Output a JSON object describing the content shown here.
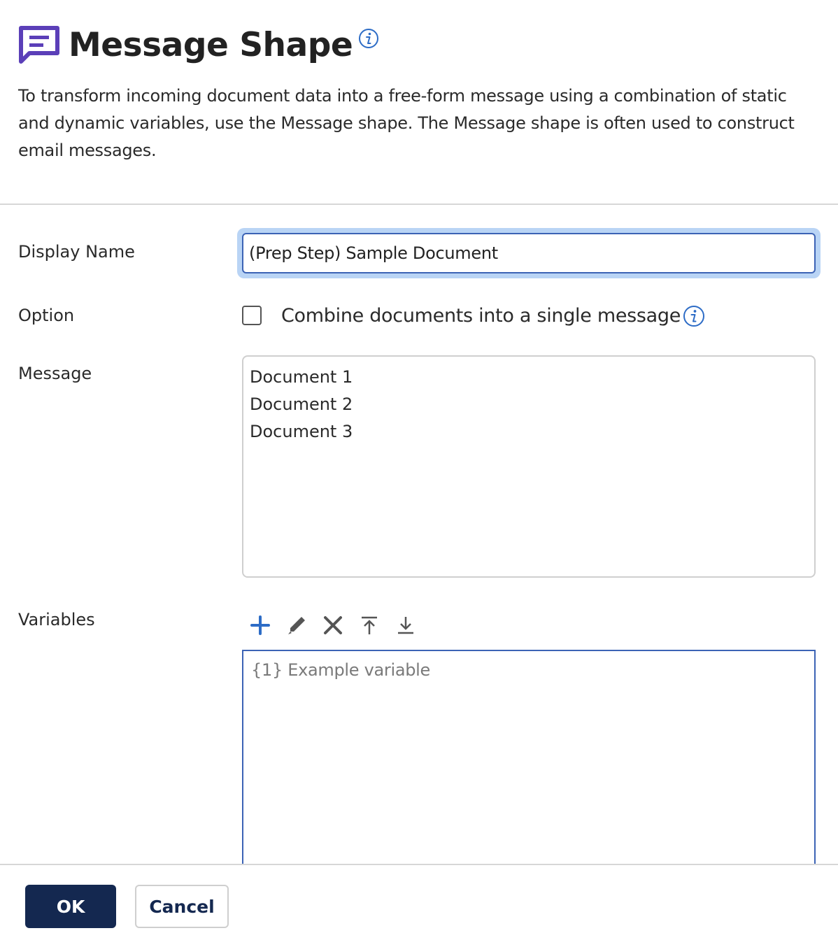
{
  "dialog": {
    "title": "Message Shape",
    "description": "To transform incoming document data into a free-form message using a combination of static and dynamic variables, use the Message shape. The Message shape is often used to construct email messages.",
    "icon": "message-shape-icon",
    "accent_color": "#5b3fb8"
  },
  "form": {
    "display_name_label": "Display Name",
    "display_name_value": "(Prep Step) Sample Document",
    "option_label": "Option",
    "combine_label": "Combine documents into a single message",
    "combine_checked": false,
    "message_label": "Message",
    "message_lines": [
      "Document 1",
      "Document 2",
      "Document 3"
    ],
    "variables_label": "Variables",
    "variables": [
      "{1} Example variable"
    ]
  },
  "toolbar": {
    "add": "plus-icon",
    "edit": "pencil-icon",
    "delete": "x-icon",
    "move_top": "move-to-top-icon",
    "move_bottom": "move-to-bottom-icon",
    "add_color": "#2d6cc6"
  },
  "footer": {
    "ok_label": "OK",
    "cancel_label": "Cancel"
  }
}
